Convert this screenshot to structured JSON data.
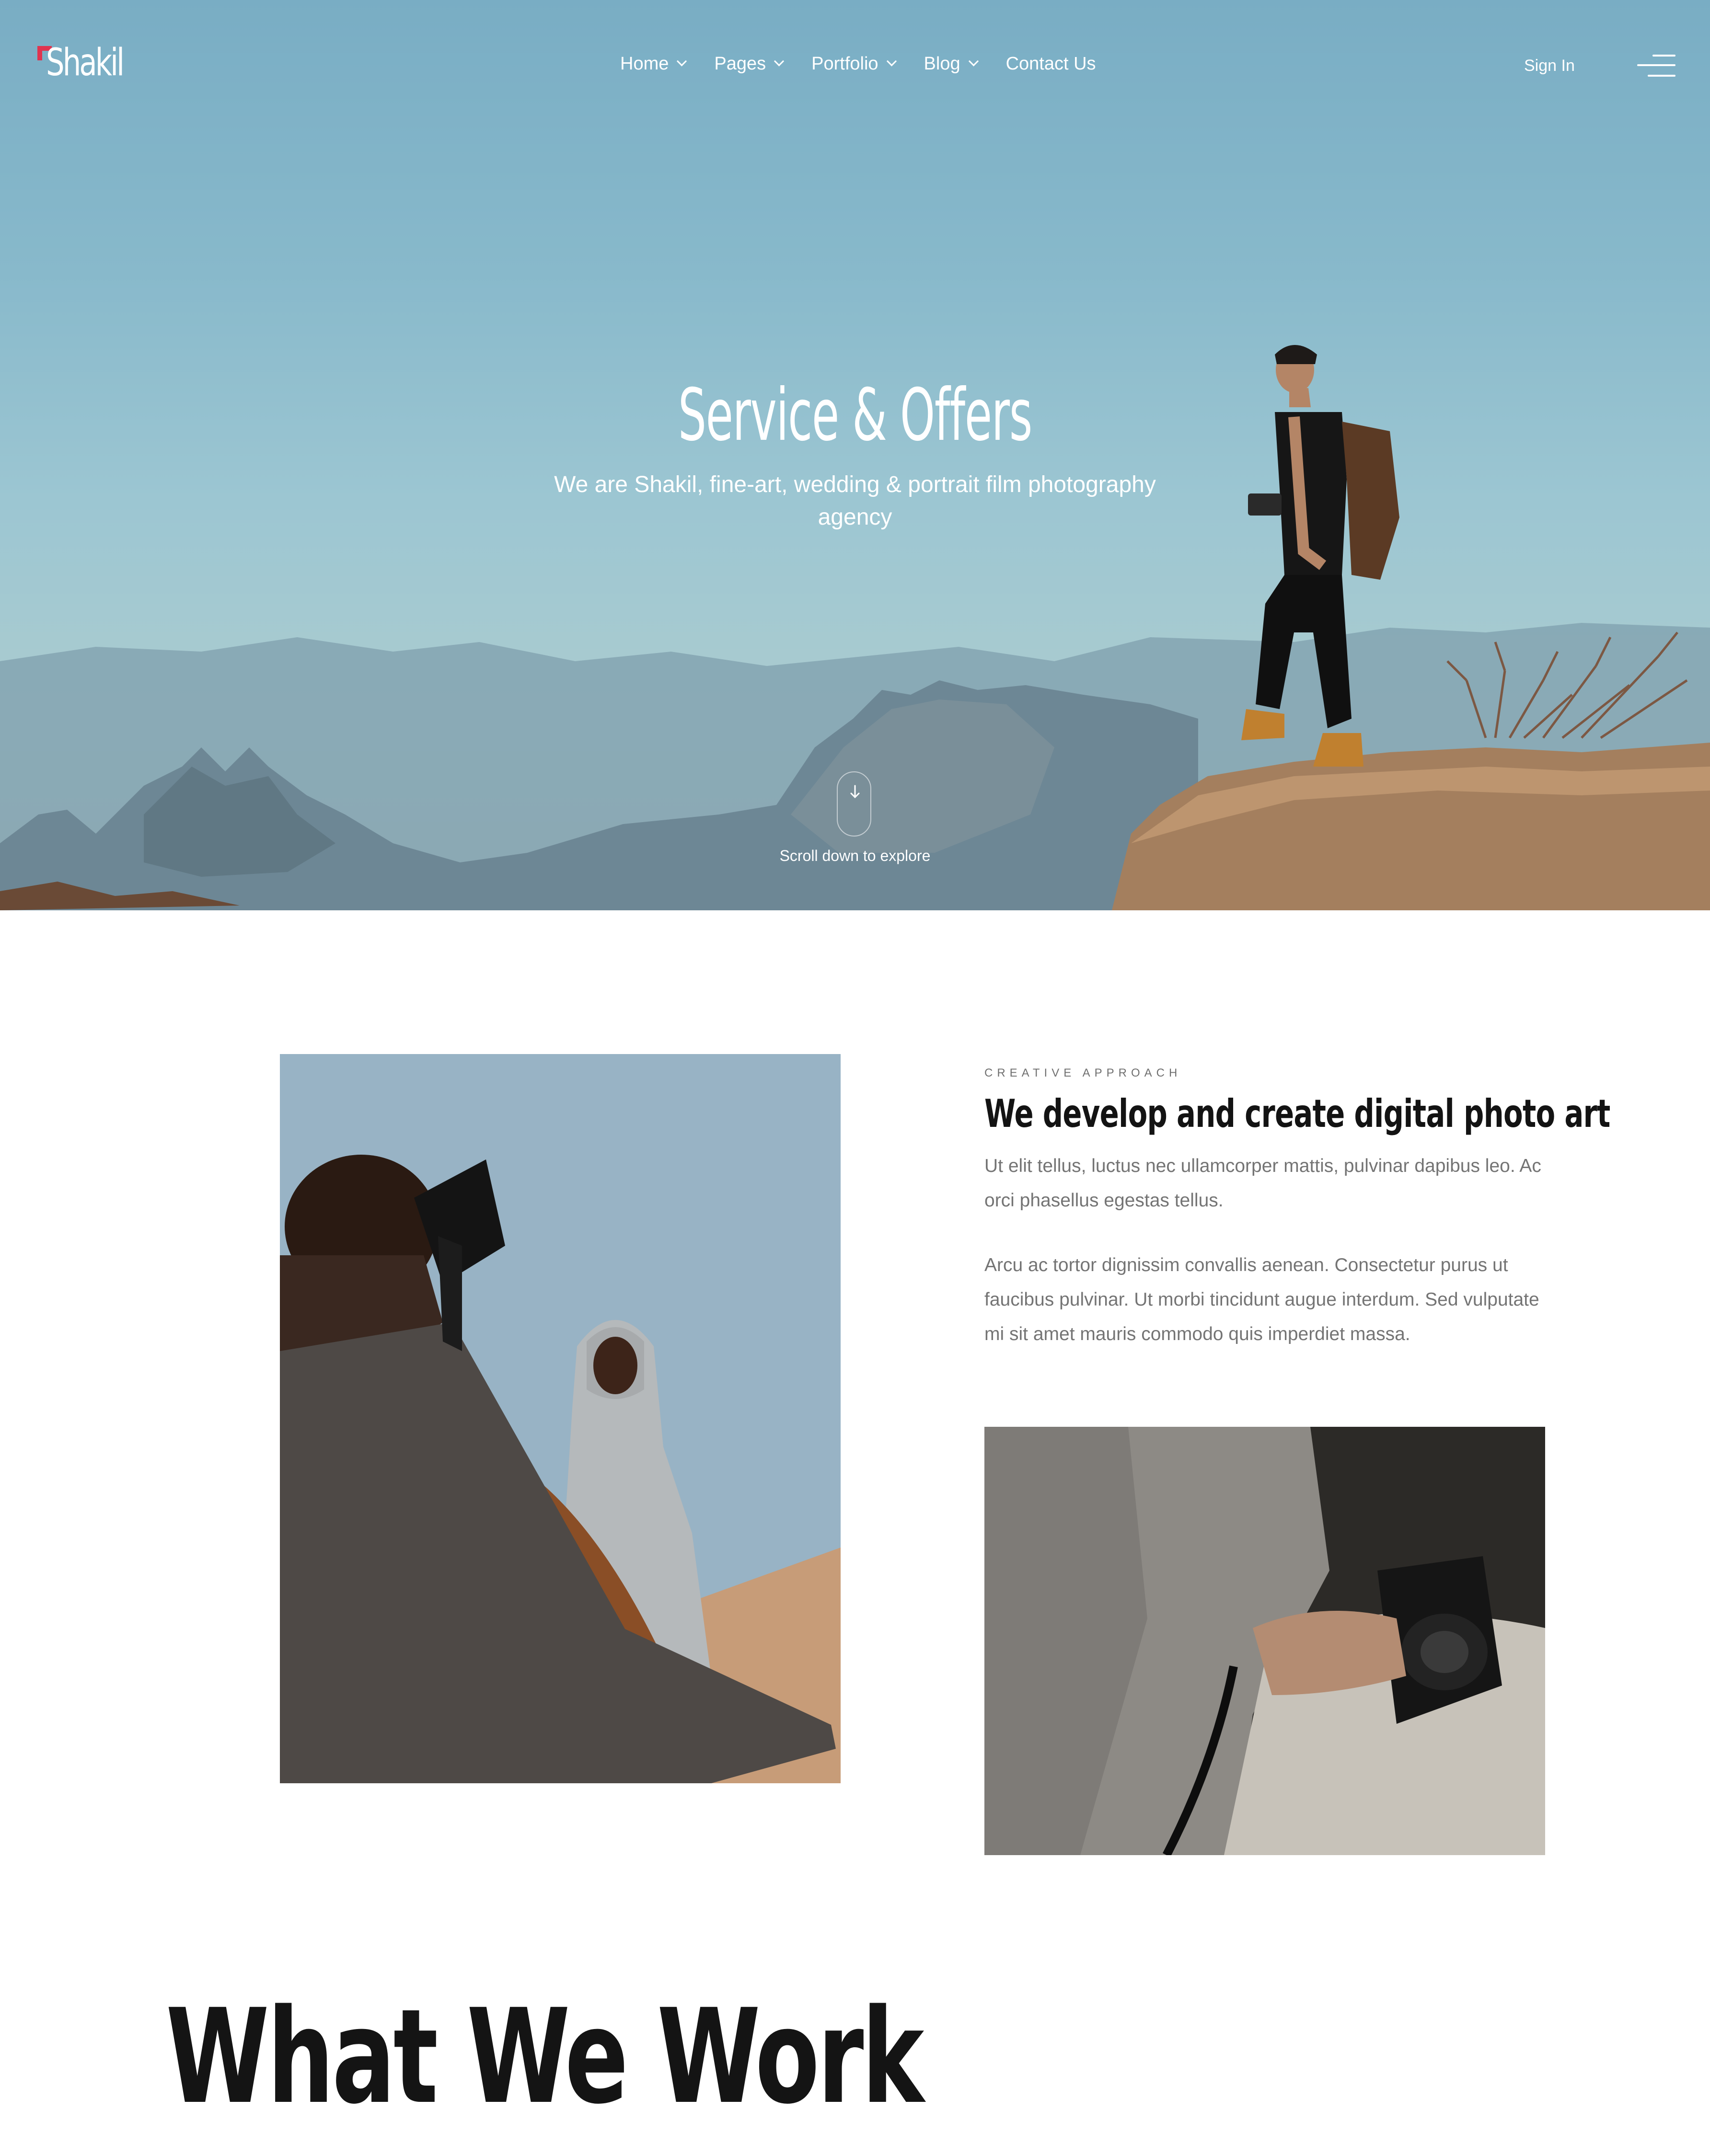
{
  "brand": {
    "name": "Shakil",
    "accent_color": "#e0344f"
  },
  "nav": {
    "items": [
      {
        "label": "Home",
        "has_dropdown": true
      },
      {
        "label": "Pages",
        "has_dropdown": true
      },
      {
        "label": "Portfolio",
        "has_dropdown": true
      },
      {
        "label": "Blog",
        "has_dropdown": true
      },
      {
        "label": "Contact Us",
        "has_dropdown": false
      }
    ],
    "sign_in": "Sign In",
    "menu_icon": "hamburger-menu-icon"
  },
  "hero": {
    "title": "Service & Offers",
    "subtitle": "We are Shakil, fine-art, wedding & portrait film photography agency",
    "scroll_text": "Scroll down to explore",
    "scroll_icon": "arrow-down-icon"
  },
  "about": {
    "eyebrow": "CREATIVE APPROACH",
    "title": "We develop and create digital photo art",
    "paragraph_1": "Ut elit tellus, luctus nec ullamcorper mattis, pulvinar dapibus leo. Ac orci phasellus egestas tellus.",
    "paragraph_2": "Arcu ac tortor dignissim convallis aenean. Consectetur purus ut faucibus pulvinar. Ut morbi tincidunt augue interdum. Sed vulputate mi sit amet mauris commodo quis imperdiet massa."
  },
  "work": {
    "title": "What We Work"
  }
}
